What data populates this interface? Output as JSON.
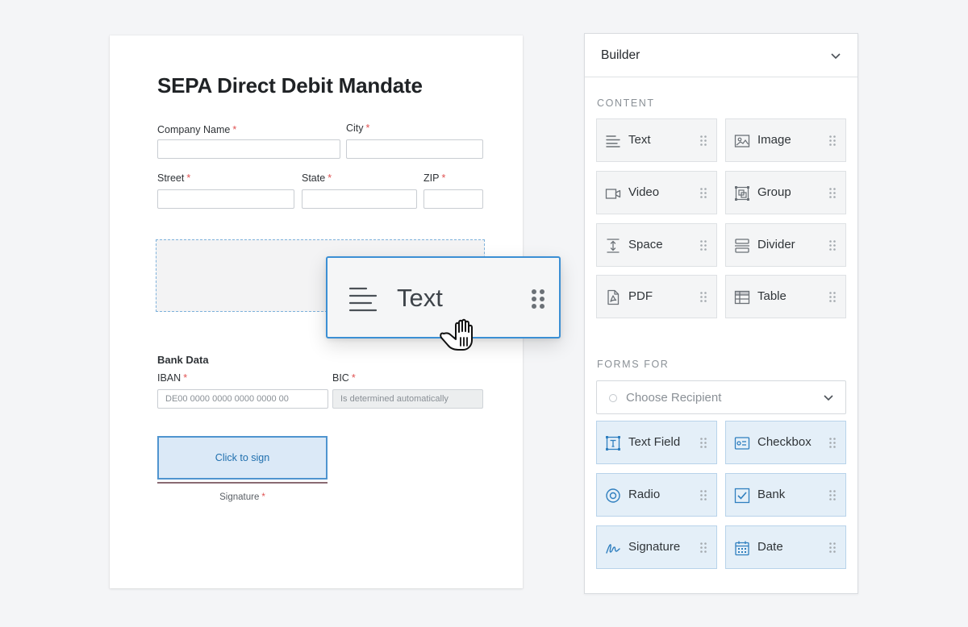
{
  "document": {
    "title": "SEPA Direct Debit Mandate",
    "required_mark": "*",
    "fields": {
      "company_name": {
        "label": "Company Name",
        "value": ""
      },
      "city": {
        "label": "City",
        "value": ""
      },
      "street": {
        "label": "Street",
        "value": ""
      },
      "state": {
        "label": "State",
        "value": ""
      },
      "zip": {
        "label": "ZIP",
        "value": ""
      },
      "iban": {
        "label": "IBAN",
        "placeholder": "DE00 0000 0000 0000 0000 00"
      },
      "bic": {
        "label": "BIC",
        "placeholder": "Is determined automatically"
      }
    },
    "bank_section_title": "Bank Data",
    "signature": {
      "button_label": "Click to sign",
      "label": "Signature"
    }
  },
  "drag_preview": {
    "label": "Text",
    "icon": "align-left-icon"
  },
  "builder": {
    "title": "Builder",
    "content_section": "CONTENT",
    "content_items": [
      {
        "label": "Text",
        "icon": "align-left-icon"
      },
      {
        "label": "Image",
        "icon": "image-icon"
      },
      {
        "label": "Video",
        "icon": "video-icon"
      },
      {
        "label": "Group",
        "icon": "group-icon"
      },
      {
        "label": "Space",
        "icon": "space-icon"
      },
      {
        "label": "Divider",
        "icon": "divider-icon"
      },
      {
        "label": "PDF",
        "icon": "pdf-icon"
      },
      {
        "label": "Table",
        "icon": "table-icon"
      }
    ],
    "forms_section": "FORMS FOR",
    "recipient_placeholder": "Choose Recipient",
    "form_items": [
      {
        "label": "Text Field",
        "icon": "text-field-icon"
      },
      {
        "label": "Checkbox",
        "icon": "checkbox-field-icon"
      },
      {
        "label": "Radio",
        "icon": "radio-icon"
      },
      {
        "label": "Bank",
        "icon": "bank-check-icon"
      },
      {
        "label": "Signature",
        "icon": "signature-icon"
      },
      {
        "label": "Date",
        "icon": "calendar-icon"
      }
    ]
  },
  "colors": {
    "accent": "#3b8fd4",
    "form_tile_bg": "#e4eff8",
    "required": "#e05252"
  }
}
